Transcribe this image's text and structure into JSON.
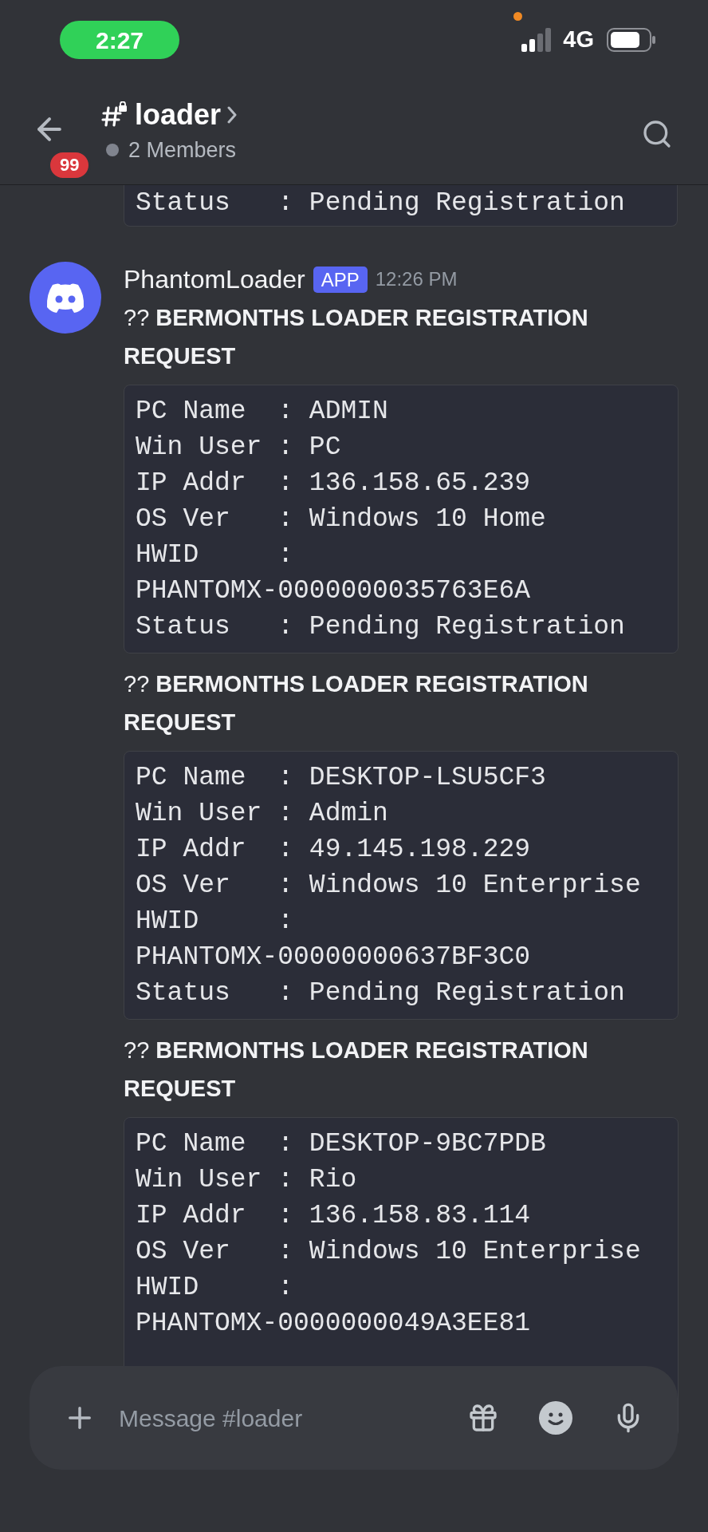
{
  "status_bar": {
    "time": "2:27",
    "network": "4G"
  },
  "header": {
    "channel": "loader",
    "unread_badge": "99",
    "members": "2 Members"
  },
  "top_block": {
    "lines": [
      "Status   : Pending Registration"
    ]
  },
  "message": {
    "author": "PhantomLoader",
    "tag": "APP",
    "time": "12:26 PM",
    "embeds": [
      {
        "title": "?? **BERMONTHS LOADER REGISTRATION REQUEST**",
        "lines": [
          "PC Name  : ADMIN",
          "Win User : PC",
          "IP Addr  : 136.158.65.239",
          "OS Ver   : Windows 10 Home",
          "HWID     :",
          "PHANTOMX-0000000035763E6A",
          "Status   : Pending Registration"
        ]
      },
      {
        "title": "?? **BERMONTHS LOADER REGISTRATION REQUEST**",
        "lines": [
          "PC Name  : DESKTOP-LSU5CF3",
          "Win User : Admin",
          "IP Addr  : 49.145.198.229",
          "OS Ver   : Windows 10 Enterprise",
          "HWID     :",
          "PHANTOMX-00000000637BF3C0",
          "Status   : Pending Registration"
        ]
      },
      {
        "title": "?? **BERMONTHS LOADER REGISTRATION REQUEST**",
        "lines": [
          "PC Name  : DESKTOP-9BC7PDB",
          "Win User : Rio",
          "IP Addr  : 136.158.83.114",
          "OS Ver   : Windows 10 Enterprise",
          "HWID     :",
          "PHANTOMX-0000000049A3EE81"
        ]
      }
    ]
  },
  "composer": {
    "placeholder": "Message #loader"
  }
}
